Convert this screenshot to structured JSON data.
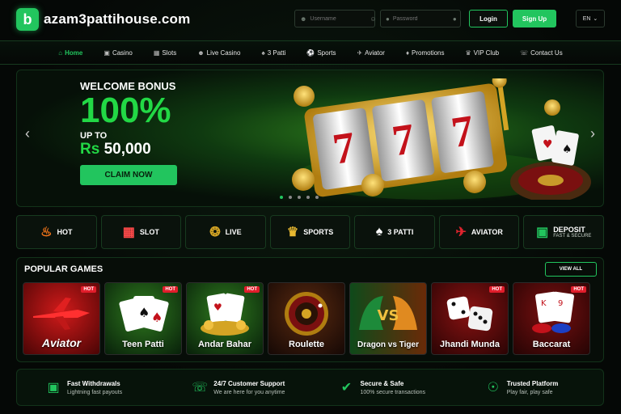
{
  "header": {
    "logo_text": "azam3pattihouse.com",
    "username_placeholder": "Username",
    "password_placeholder": "Password",
    "login_label": "Login",
    "signup_label": "Sign Up",
    "language": "EN",
    "accent_color": "#22c55e"
  },
  "nav": {
    "items": [
      {
        "label": "Home",
        "icon": "home-icon"
      },
      {
        "label": "Casino",
        "icon": "casino-icon"
      },
      {
        "label": "Slots",
        "icon": "slots-icon"
      },
      {
        "label": "Live Casino",
        "icon": "user-icon"
      },
      {
        "label": "3 Patti",
        "icon": "cards-icon"
      },
      {
        "label": "Sports",
        "icon": "ball-icon"
      },
      {
        "label": "Aviator",
        "icon": "plane-icon"
      },
      {
        "label": "Promotions",
        "icon": "gift-icon"
      },
      {
        "label": "VIP Club",
        "icon": "crown-icon"
      },
      {
        "label": "Contact Us",
        "icon": "phone-icon"
      }
    ]
  },
  "banner": {
    "welcome": "WELCOME BONUS",
    "percent": "100%",
    "up_to": "UP TO",
    "currency": "Rs",
    "amount": "50,000",
    "cta": "CLAIM NOW"
  },
  "categories": [
    {
      "label": "HOT",
      "icon": "fire-icon"
    },
    {
      "label": "SLOT",
      "icon": "slot-machine-icon"
    },
    {
      "label": "LIVE",
      "icon": "roulette-icon"
    },
    {
      "label": "SPORTS",
      "icon": "trophy-icon"
    },
    {
      "label": "3 PATTI",
      "icon": "cards-icon"
    },
    {
      "label": "AVIATOR",
      "icon": "plane-icon"
    },
    {
      "label": "DEPOSIT",
      "sub": "FAST & SECURE",
      "icon": "wallet-icon"
    }
  ],
  "popular": {
    "title": "POPULAR GAMES",
    "view_all": "VIEW ALL",
    "hot_badge": "HOT",
    "games": [
      {
        "name": "Aviator",
        "hot": true
      },
      {
        "name": "Teen Patti",
        "hot": true
      },
      {
        "name": "Andar Bahar",
        "hot": true
      },
      {
        "name": "Roulette",
        "hot": false
      },
      {
        "name": "Dragon vs Tiger",
        "hot": false
      },
      {
        "name": "Jhandi Munda",
        "hot": true
      },
      {
        "name": "Baccarat",
        "hot": true
      }
    ]
  },
  "features": [
    {
      "title": "Fast Withdrawals",
      "sub": "Lightning fast payouts",
      "icon": "wallet-icon"
    },
    {
      "title": "24/7 Customer Support",
      "sub": "We are here for you anytime",
      "icon": "headset-icon"
    },
    {
      "title": "Secure & Safe",
      "sub": "100% secure transactions",
      "icon": "shield-icon"
    },
    {
      "title": "Trusted Platform",
      "sub": "Play fair, play safe",
      "icon": "globe-icon"
    }
  ]
}
